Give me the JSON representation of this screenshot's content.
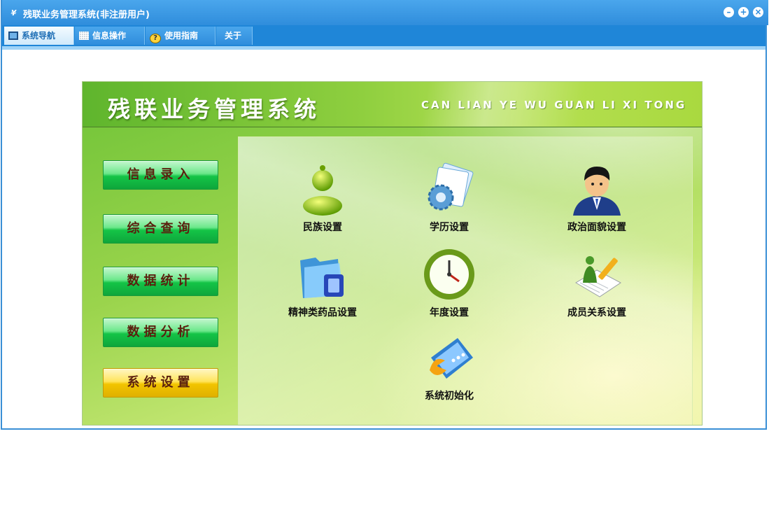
{
  "window": {
    "app_icon": "¥",
    "title": "残联业务管理系统(非注册用户)",
    "controls": [
      "minimize-icon",
      "restore-icon",
      "close-icon"
    ]
  },
  "tabs": [
    {
      "label": "系统导航",
      "icon": "monitor-icon",
      "active": true
    },
    {
      "label": "信息操作",
      "icon": "grid-icon",
      "active": false
    },
    {
      "label": "使用指南",
      "icon": "help-icon",
      "active": false
    },
    {
      "label": "关于",
      "icon": "",
      "active": false
    }
  ],
  "header": {
    "title": "残联业务管理系统",
    "subtitle": "CAN LIAN YE WU GUAN LI XI TONG"
  },
  "sidebar": {
    "buttons": [
      {
        "label": "信息录入",
        "active": false
      },
      {
        "label": "综合查询",
        "active": false
      },
      {
        "label": "数据统计",
        "active": false
      },
      {
        "label": "数据分析",
        "active": false
      },
      {
        "label": "系统设置",
        "active": true
      }
    ]
  },
  "settings": {
    "items": [
      {
        "label": "民族设置",
        "icon": "person-icon"
      },
      {
        "label": "学历设置",
        "icon": "gear-folder-icon"
      },
      {
        "label": "政治面貌设置",
        "icon": "user-avatar-icon"
      },
      {
        "label": "精神类药品设置",
        "icon": "folder-icon"
      },
      {
        "label": "年度设置",
        "icon": "clock-icon"
      },
      {
        "label": "成员关系设置",
        "icon": "notepad-pencil-icon"
      },
      {
        "label": "系统初始化",
        "icon": "book-icon"
      }
    ]
  },
  "colors": {
    "title_bar": "#2f8ddc",
    "tab_bar": "#1f86d8",
    "button_green": "#14c447",
    "button_active_yellow": "#f2c400",
    "button_text": "#5a1f0e"
  }
}
